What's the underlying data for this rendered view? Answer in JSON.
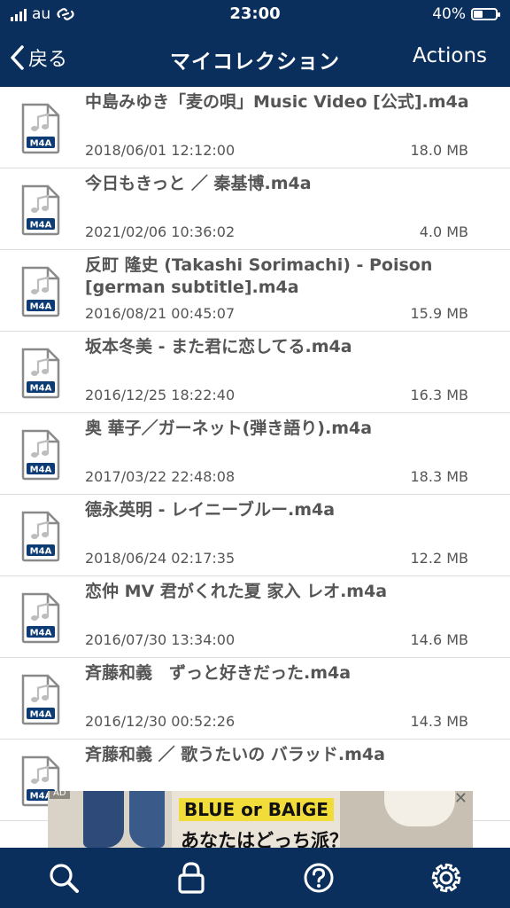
{
  "status_bar": {
    "carrier": "au",
    "time": "23:00",
    "battery": "40%",
    "battery_level": 0.4
  },
  "nav": {
    "back_label": "戻る",
    "title": "マイコレクション",
    "actions_label": "Actions"
  },
  "files": [
    {
      "name": "中島みゆき「麦の唄」Music Video [公式].m4a",
      "date": "2018/06/01 12:12:00",
      "size": "18.0 MB",
      "type_badge": "M4A"
    },
    {
      "name": "今日もきっと ／ 秦基博.m4a",
      "date": "2021/02/06 10:36:02",
      "size": "4.0 MB",
      "type_badge": "M4A"
    },
    {
      "name": "反町 隆史 (Takashi Sorimachi) - Poison [german subtitle].m4a",
      "date": "2016/08/21 00:45:07",
      "size": "15.9 MB",
      "type_badge": "M4A"
    },
    {
      "name": "坂本冬美 - また君に恋してる.m4a",
      "date": "2016/12/25 18:22:40",
      "size": "16.3 MB",
      "type_badge": "M4A"
    },
    {
      "name": "奥 華子／ガーネット(弾き語り).m4a",
      "date": "2017/03/22 22:48:08",
      "size": "18.3 MB",
      "type_badge": "M4A"
    },
    {
      "name": "德永英明 - レイニーブルー.m4a",
      "date": "2018/06/24 02:17:35",
      "size": "12.2 MB",
      "type_badge": "M4A"
    },
    {
      "name": "恋仲 MV 君がくれた夏 家入 レオ.m4a",
      "date": "2016/07/30 13:34:00",
      "size": "14.6 MB",
      "type_badge": "M4A"
    },
    {
      "name": "斉藤和義　ずっと好きだった.m4a",
      "date": "2016/12/30 00:52:26",
      "size": "14.3 MB",
      "type_badge": "M4A"
    },
    {
      "name": "斉藤和義 ／ 歌うたいの バラッド.m4a",
      "date": "",
      "size": "",
      "type_badge": "M4A"
    }
  ],
  "ad": {
    "label": "AD",
    "headline": "BLUE or BAIGE",
    "subline": "あなたはどっち派？",
    "close": "✕"
  },
  "tab_bar": {
    "icons": [
      "search-icon",
      "lock-icon",
      "help-icon",
      "gear-icon"
    ]
  },
  "colors": {
    "brand_navy": "#0b2f5c",
    "badge_blue": "#0d3b73",
    "text_gray": "#555555"
  }
}
